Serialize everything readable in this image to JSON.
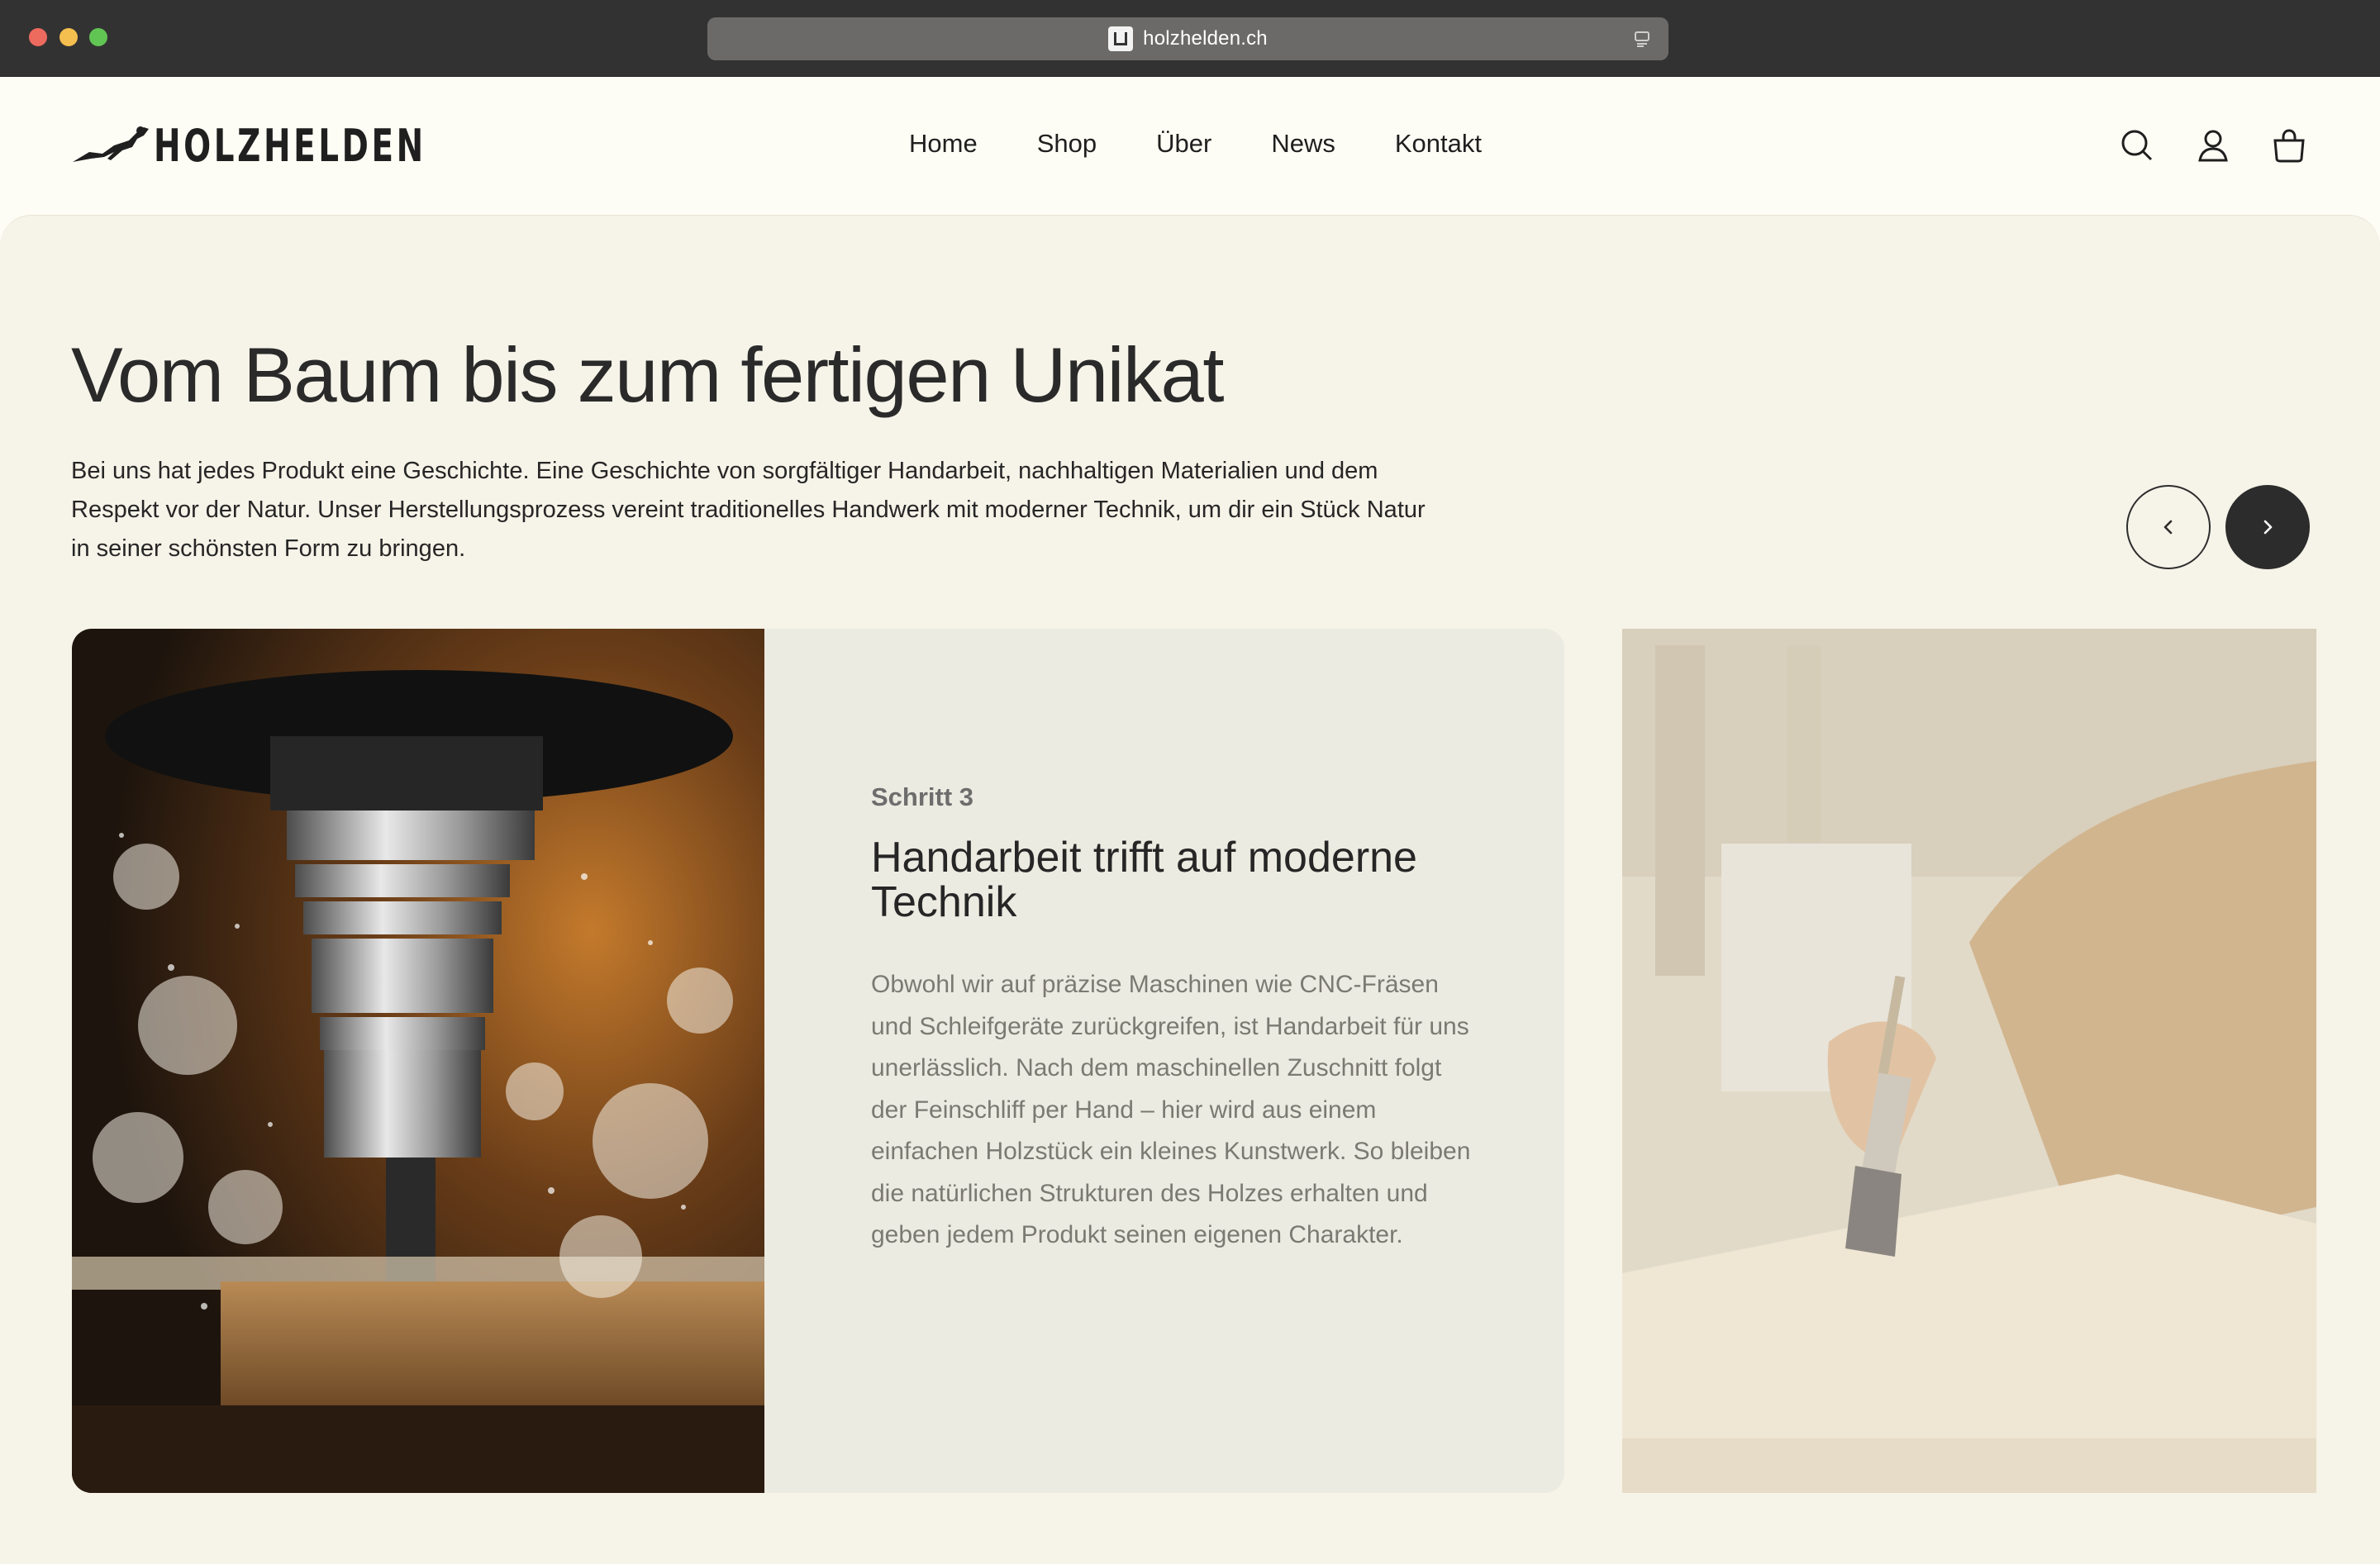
{
  "browser": {
    "url": "holzhelden.ch"
  },
  "header": {
    "logo_text": "HOLZHELDEN",
    "nav": [
      "Home",
      "Shop",
      "Über",
      "News",
      "Kontakt"
    ],
    "icons": [
      "search-icon",
      "account-icon",
      "cart-icon"
    ]
  },
  "hero": {
    "title": "Vom Baum bis zum fertigen Unikat",
    "intro": "Bei uns hat jedes Produkt eine Geschichte. Eine Geschichte von sorgfältiger Handarbeit, nachhaltigen Materialien und dem Respekt vor der Natur. Unser Herstellungsprozess vereint traditionelles Handwerk mit moderner Technik, um dir ein Stück Natur in seiner schönsten Form zu bringen."
  },
  "slider": {
    "prev_icon": "chevron-left-icon",
    "next_icon": "chevron-right-icon",
    "active_slide": {
      "step": "Schritt 3",
      "title": "Handarbeit trifft auf moderne Technik",
      "body": "Obwohl wir auf präzise Maschinen wie CNC-Fräsen und Schleifgeräte zurückgreifen, ist Handarbeit für uns unerlässlich. Nach dem maschinellen Zuschnitt folgt der Feinschliff per Hand – hier wird aus einem einfachen Holzstück ein kleines Kunstwerk. So bleiben die natürlichen Strukturen des Holzes erhalten und geben jedem Produkt seinen eigenen Charakter."
    }
  },
  "colors": {
    "page_background": "#f6f3e8",
    "header_background": "#fefdf5",
    "card_background": "#ecebe1",
    "text_dark": "#262626",
    "text_muted": "#7a7a72",
    "button_dark": "#2c2c2c"
  }
}
